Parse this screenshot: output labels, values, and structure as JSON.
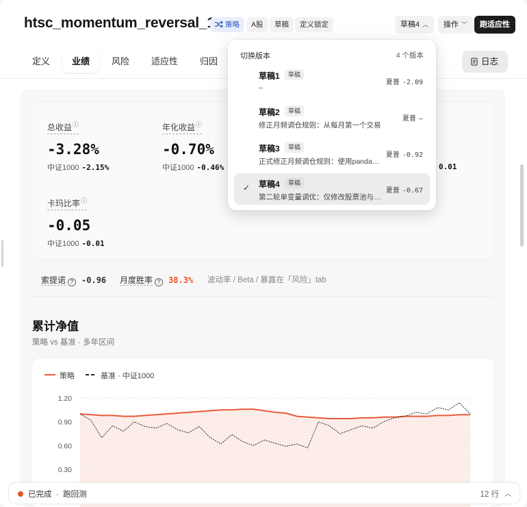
{
  "header": {
    "title": "htsc_momentum_reversal_1m",
    "chips": {
      "strategy": "策略",
      "market": "A股",
      "status": "草稿",
      "lock": "定义锁定"
    },
    "version_button": "草稿4",
    "actions_button": "操作",
    "run_button": "跑适应性"
  },
  "tabs": {
    "t0": "定义",
    "t1": "业绩",
    "t2": "风险",
    "t3": "适应性",
    "t4": "归因",
    "log": "日志"
  },
  "metrics": {
    "total_return": {
      "label": "总收益",
      "value": "-3.28%",
      "bench_label": "中证1000",
      "bench_value": "-2.15%"
    },
    "annual_return": {
      "label": "年化收益",
      "value": "-0.70%",
      "bench_label": "中证1000",
      "bench_value": "-0.46%"
    },
    "partial_bench_value": "0.01",
    "calmar": {
      "label": "卡玛比率",
      "value": "-0.05",
      "bench_label": "中证1000",
      "bench_value": "-0.01"
    }
  },
  "stats": {
    "sortino_label": "索提诺",
    "sortino_value": "-0.96",
    "winrate_label": "月度胜率",
    "winrate_value": "38.3%",
    "note": "波动率 / Beta / 暴露在「风险」tab"
  },
  "chart_section": {
    "title": "累计净值",
    "subtitle": "策略 vs 基准 · 多年区间"
  },
  "chart_data": {
    "type": "line",
    "series": [
      {
        "name": "策略",
        "style": "solid",
        "color": "#ea5a3a",
        "values": [
          1.0,
          0.99,
          0.98,
          0.98,
          0.97,
          0.97,
          0.98,
          0.99,
          1.0,
          1.01,
          1.02,
          1.03,
          1.04,
          1.05,
          1.05,
          1.06,
          1.06,
          1.04,
          1.02,
          1.01,
          0.97,
          0.96,
          0.95,
          0.94,
          0.94,
          0.94,
          0.95,
          0.95,
          0.96,
          0.96,
          0.97,
          0.97,
          0.97,
          0.98,
          0.98,
          0.99,
          0.99
        ]
      },
      {
        "name": "基准",
        "style": "dashed",
        "color": "#222222",
        "values": [
          1.0,
          0.92,
          0.7,
          0.85,
          0.78,
          0.9,
          0.84,
          0.82,
          0.88,
          0.8,
          0.76,
          0.84,
          0.7,
          0.62,
          0.74,
          0.65,
          0.6,
          0.67,
          0.63,
          0.59,
          0.62,
          0.57,
          0.9,
          0.85,
          0.75,
          0.8,
          0.85,
          0.82,
          0.9,
          0.95,
          0.97,
          1.02,
          1.0,
          1.08,
          1.05,
          1.14,
          1.0
        ]
      }
    ],
    "legend_suffix": "· 中证1000",
    "ylim": [
      0.3,
      1.2
    ],
    "yticks": [
      "1.20",
      "0.90",
      "0.60",
      "0.30"
    ],
    "grid": true,
    "area_fill_under": "策略"
  },
  "dropdown": {
    "title": "切换版本",
    "count": "4 个版本",
    "items": [
      {
        "name": "草稿1",
        "badge": "草稿",
        "desc": "–",
        "sharpe_label": "夏普",
        "sharpe_value": "-2.09",
        "selected": false
      },
      {
        "name": "草稿2",
        "badge": "草稿",
        "desc": "修正月频调仓规则：从每月第一个交易日…",
        "sharpe_label": "夏普",
        "sharpe_value": "–",
        "selected": false
      },
      {
        "name": "草稿3",
        "badge": "草稿",
        "desc": "正式修正月频调仓规则：使用panda…",
        "sharpe_label": "夏普",
        "sharpe_value": "-0.92",
        "selected": false
      },
      {
        "name": "草稿4",
        "badge": "草稿",
        "desc": "第二轮单变量调优：仅修改股票池与…",
        "sharpe_label": "夏普",
        "sharpe_value": "-0.67",
        "selected": true
      }
    ]
  },
  "statusbar": {
    "status": "已完成",
    "sep": "·",
    "action": "跑回测",
    "rows": "12 行"
  }
}
